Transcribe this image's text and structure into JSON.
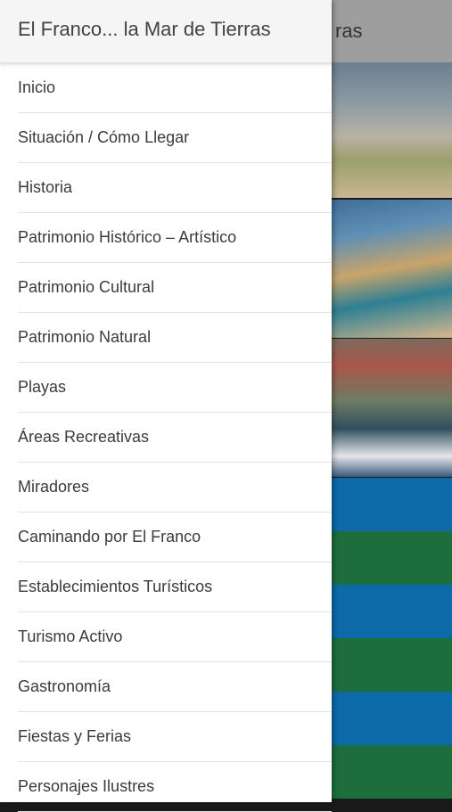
{
  "drawer": {
    "title": "El Franco... la Mar de Tierras",
    "items": [
      {
        "label": "Inicio"
      },
      {
        "label": "Situación / Cómo Llegar"
      },
      {
        "label": "Historia"
      },
      {
        "label": "Patrimonio Histórico – Artístico"
      },
      {
        "label": "Patrimonio Cultural"
      },
      {
        "label": "Patrimonio Natural"
      },
      {
        "label": "Playas"
      },
      {
        "label": "Áreas Recreativas"
      },
      {
        "label": "Miradores"
      },
      {
        "label": "Caminando por El Franco"
      },
      {
        "label": "Establecimientos Turísticos"
      },
      {
        "label": "Turismo Activo"
      },
      {
        "label": "Gastronomía"
      },
      {
        "label": "Fiestas y Ferias"
      },
      {
        "label": "Personajes Ilustres"
      }
    ]
  },
  "background": {
    "toolbar_title_fragment": "ras"
  },
  "colors": {
    "stripe_blue": "#0d6aa8",
    "stripe_green": "#1d6d3d"
  }
}
